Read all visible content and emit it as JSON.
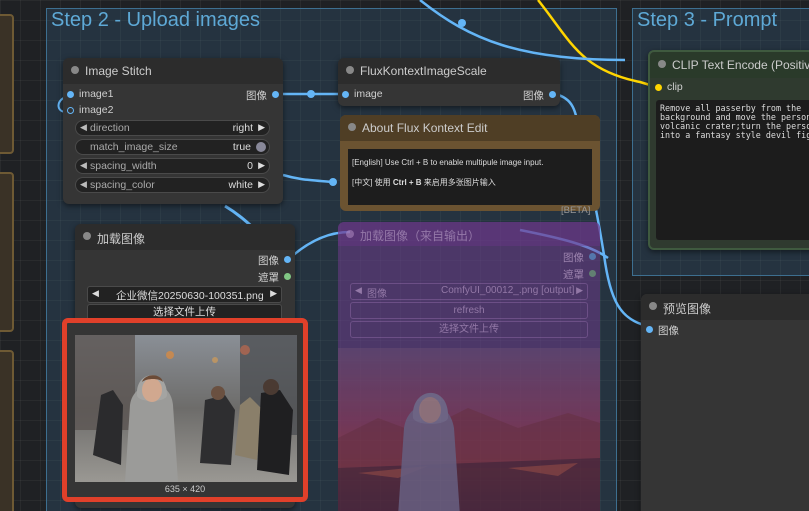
{
  "groups": {
    "step2": {
      "title": "Step 2 - Upload images"
    },
    "step3": {
      "title": "Step 3 - Prompt"
    }
  },
  "image_stitch": {
    "title": "Image Stitch",
    "inputs": [
      "image1",
      "image2"
    ],
    "output": "图像",
    "widgets": {
      "direction": {
        "label": "direction",
        "value": "right"
      },
      "match_image_size": {
        "label": "match_image_size",
        "value": "true"
      },
      "spacing_width": {
        "label": "spacing_width",
        "value": "0"
      },
      "spacing_color": {
        "label": "spacing_color",
        "value": "white"
      }
    }
  },
  "scale_node": {
    "title": "FluxKontextImageScale",
    "input": "image",
    "output": "图像"
  },
  "about_node": {
    "title": "About Flux Kontext Edit",
    "line_en": "[English] Use Ctrl + B to enable multipule image input.",
    "line_zh_a": "[中文] 使用 ",
    "line_zh_key": "Ctrl + B",
    "line_zh_b": " 来启用多张图片输入",
    "badge": "[BETA]"
  },
  "load_image": {
    "title": "加载图像",
    "output_image": "图像",
    "output_mask": "遮罩",
    "filename": "企业微信20250630-100351.png",
    "upload_label": "选择文件上传",
    "dimensions": "635 × 420"
  },
  "load_image_output": {
    "title": "加载图像（来自输出）",
    "output_image": "图像",
    "output_mask": "遮罩",
    "filename_label": "图像",
    "filename": "ComfyUI_00012_.png [output]",
    "refresh_label": "refresh",
    "upload_label": "选择文件上传"
  },
  "clip_node": {
    "title": "CLIP Text Encode (Positive",
    "input": "clip",
    "prompt_text": "Remove all passerby from the background and move the person to a volcanic crater;turn the person into a fantasy style devil fighter"
  },
  "preview_node": {
    "title": "预览图像",
    "input": "图像"
  },
  "colors": {
    "wire_image": "#64b5f6",
    "wire_clip": "#ffd500",
    "highlight": "#e0402a",
    "group_title": "#5ea9d6"
  }
}
